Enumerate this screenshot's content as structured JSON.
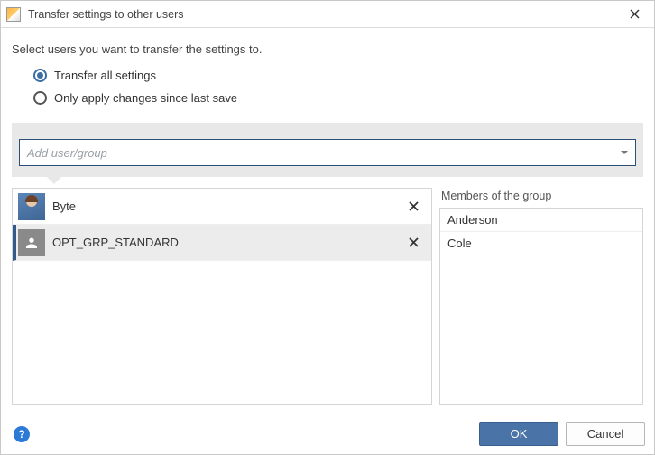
{
  "title": "Transfer settings to other users",
  "instruction": "Select users you want to transfer the settings to.",
  "options": {
    "all": {
      "label": "Transfer all settings",
      "checked": true
    },
    "changes": {
      "label": "Only apply changes since last save",
      "checked": false
    }
  },
  "combo": {
    "placeholder": "Add user/group"
  },
  "selected_items": [
    {
      "type": "user",
      "label": "Byte"
    },
    {
      "type": "group",
      "label": "OPT_GRP_STANDARD",
      "selected": true
    }
  ],
  "members_heading": "Members of the group",
  "members": [
    "Anderson",
    "Cole"
  ],
  "buttons": {
    "ok": "OK",
    "cancel": "Cancel"
  }
}
